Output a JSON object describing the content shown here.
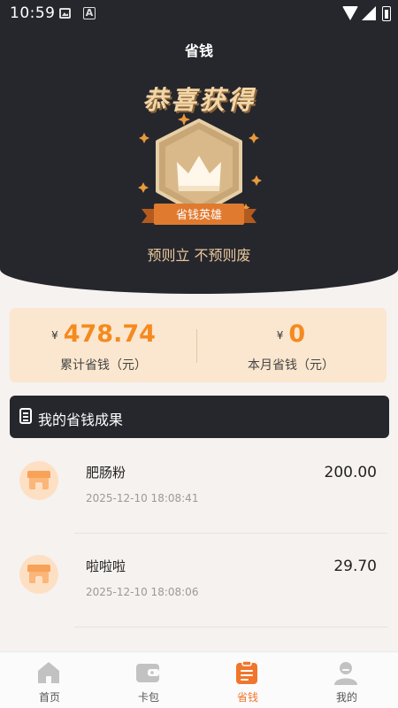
{
  "status_bar": {
    "time": "10:59"
  },
  "header": {
    "title": "省钱",
    "congrats": "恭喜获得",
    "badge_label": "省钱英雄",
    "motto": "预则立 不预则废"
  },
  "stats": {
    "currency": "¥",
    "total_saved": "478.74",
    "total_saved_label": "累计省钱（元）",
    "month_saved": "0",
    "month_saved_label": "本月省钱（元）"
  },
  "section": {
    "title": "我的省钱成果"
  },
  "records": [
    {
      "name": "肥肠粉",
      "time": "2025-12-10 18:08:41",
      "amount": "200.00"
    },
    {
      "name": "啦啦啦",
      "time": "2025-12-10 18:08:06",
      "amount": "29.70"
    }
  ],
  "tabs": [
    {
      "label": "首页",
      "icon": "home-icon"
    },
    {
      "label": "卡包",
      "icon": "wallet-icon"
    },
    {
      "label": "省钱",
      "icon": "clipboard-icon",
      "active": true
    },
    {
      "label": "我的",
      "icon": "user-icon"
    }
  ],
  "colors": {
    "accent": "#f58a1f",
    "dark": "#26272d",
    "card": "#fbe7cf"
  }
}
